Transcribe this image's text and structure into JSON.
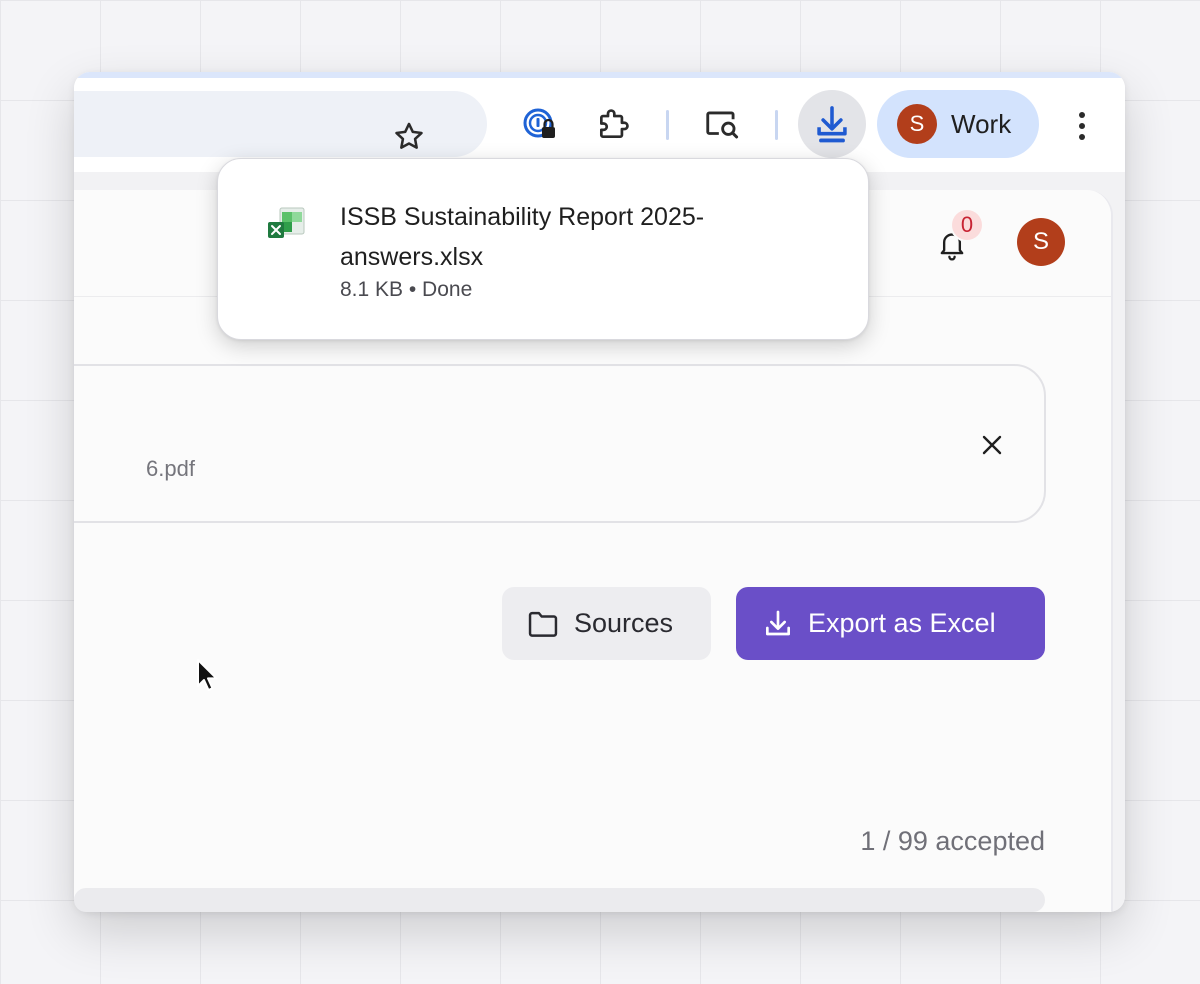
{
  "browser": {
    "profile": {
      "avatar_letter": "S",
      "label": "Work"
    },
    "toolbar_icons": [
      "star-icon",
      "password-manager-icon",
      "extensions-icon",
      "screen-search-icon",
      "download-icon",
      "more-vert-icon"
    ]
  },
  "download_popup": {
    "filename_line1": "ISSB Sustainability Report 2025-",
    "filename_line2": "answers.xlsx",
    "meta": "8.1 KB • Done",
    "file_icon": "excel-file-icon"
  },
  "app": {
    "notifications_count": "0",
    "user_avatar_letter": "S",
    "file_card": {
      "filename": "6.pdf"
    },
    "buttons": {
      "sources": "Sources",
      "export": "Export as Excel"
    },
    "accepted_status": "1 / 99 accepted",
    "colors": {
      "primary": "#6a4fc8",
      "avatar": "#b23e1b",
      "badge": "#c82333"
    }
  }
}
